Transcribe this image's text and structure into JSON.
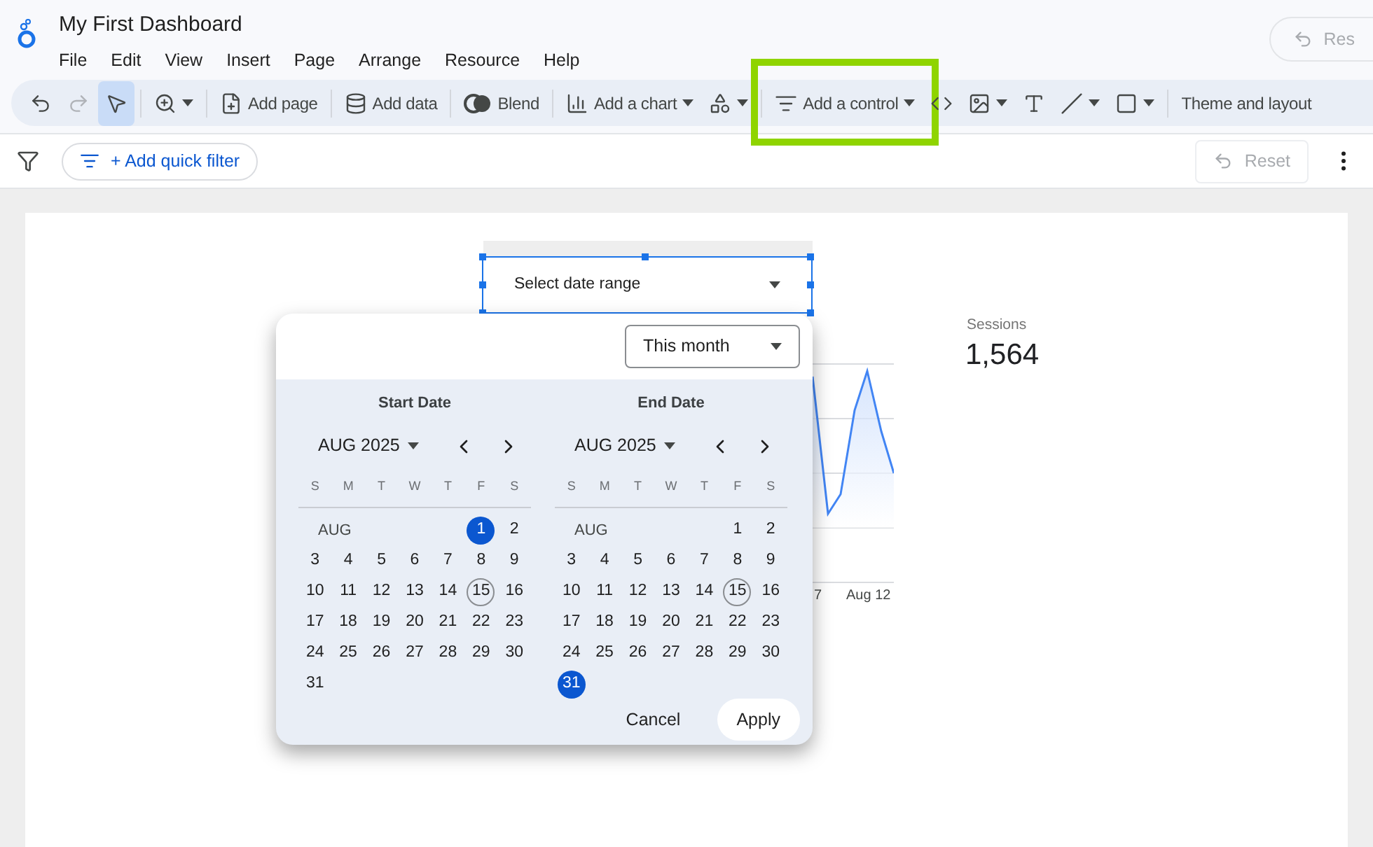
{
  "title": "My First Dashboard",
  "menu": [
    "File",
    "Edit",
    "View",
    "Insert",
    "Page",
    "Arrange",
    "Resource",
    "Help"
  ],
  "header_reset": {
    "label": "Res"
  },
  "toolbar": [
    {
      "kind": "undo",
      "disabled": false
    },
    {
      "kind": "redo",
      "disabled": true
    },
    {
      "kind": "select",
      "selected": true
    },
    {
      "kind": "zoom",
      "caret": true
    },
    {
      "kind": "page",
      "label": "Add page"
    },
    {
      "kind": "data",
      "label": "Add data"
    },
    {
      "kind": "blend",
      "label": "Blend"
    },
    {
      "kind": "chart",
      "label": "Add a chart",
      "caret": true
    },
    {
      "kind": "components",
      "caret": true
    },
    {
      "kind": "control",
      "label": "Add a control",
      "caret": true,
      "highlighted": true
    },
    {
      "kind": "code"
    },
    {
      "kind": "image",
      "caret": true
    },
    {
      "kind": "text"
    },
    {
      "kind": "line",
      "caret": true
    },
    {
      "kind": "shape",
      "caret": true
    },
    {
      "kind": "theme",
      "label": "Theme and layout"
    }
  ],
  "filter_bar": {
    "quick_filter": "+ Add quick filter",
    "reset": {
      "label": "Reset",
      "disabled": true
    }
  },
  "date_control": {
    "label": "Select date range"
  },
  "scorecard": {
    "label": "Sessions",
    "value": "1,564"
  },
  "chart_axis": [
    "7",
    "Aug 12"
  ],
  "date_picker": {
    "preset": "This month",
    "calendars": [
      {
        "title": "Start Date",
        "month": "AUG 2025",
        "weekdays": [
          "S",
          "M",
          "T",
          "W",
          "T",
          "F",
          "S"
        ],
        "month_abbr": "AUG",
        "first_row": [
          {
            "label": "1",
            "selected": true,
            "today": false
          },
          {
            "label": "2",
            "selected": false,
            "today": false
          }
        ],
        "weeks": [
          [
            {
              "label": "3",
              "selected": false,
              "today": false
            },
            {
              "label": "4",
              "selected": false,
              "today": false
            },
            {
              "label": "5",
              "selected": false,
              "today": false
            },
            {
              "label": "6",
              "selected": false,
              "today": false
            },
            {
              "label": "7",
              "selected": false,
              "today": false
            },
            {
              "label": "8",
              "selected": false,
              "today": false
            },
            {
              "label": "9",
              "selected": false,
              "today": false
            }
          ],
          [
            {
              "label": "10",
              "selected": false,
              "today": false
            },
            {
              "label": "11",
              "selected": false,
              "today": false
            },
            {
              "label": "12",
              "selected": false,
              "today": false
            },
            {
              "label": "13",
              "selected": false,
              "today": false
            },
            {
              "label": "14",
              "selected": false,
              "today": false
            },
            {
              "label": "15",
              "selected": false,
              "today": true
            },
            {
              "label": "16",
              "selected": false,
              "today": false
            }
          ],
          [
            {
              "label": "17",
              "selected": false,
              "today": false
            },
            {
              "label": "18",
              "selected": false,
              "today": false
            },
            {
              "label": "19",
              "selected": false,
              "today": false
            },
            {
              "label": "20",
              "selected": false,
              "today": false
            },
            {
              "label": "21",
              "selected": false,
              "today": false
            },
            {
              "label": "22",
              "selected": false,
              "today": false
            },
            {
              "label": "23",
              "selected": false,
              "today": false
            }
          ],
          [
            {
              "label": "24",
              "selected": false,
              "today": false
            },
            {
              "label": "25",
              "selected": false,
              "today": false
            },
            {
              "label": "26",
              "selected": false,
              "today": false
            },
            {
              "label": "27",
              "selected": false,
              "today": false
            },
            {
              "label": "28",
              "selected": false,
              "today": false
            },
            {
              "label": "29",
              "selected": false,
              "today": false
            },
            {
              "label": "30",
              "selected": false,
              "today": false
            }
          ],
          [
            {
              "label": "31",
              "selected": false,
              "today": false
            }
          ]
        ]
      },
      {
        "title": "End Date",
        "month": "AUG 2025",
        "weekdays": [
          "S",
          "M",
          "T",
          "W",
          "T",
          "F",
          "S"
        ],
        "month_abbr": "AUG",
        "first_row": [
          {
            "label": "1",
            "selected": false,
            "today": false
          },
          {
            "label": "2",
            "selected": false,
            "today": false
          }
        ],
        "weeks": [
          [
            {
              "label": "3",
              "selected": false,
              "today": false
            },
            {
              "label": "4",
              "selected": false,
              "today": false
            },
            {
              "label": "5",
              "selected": false,
              "today": false
            },
            {
              "label": "6",
              "selected": false,
              "today": false
            },
            {
              "label": "7",
              "selected": false,
              "today": false
            },
            {
              "label": "8",
              "selected": false,
              "today": false
            },
            {
              "label": "9",
              "selected": false,
              "today": false
            }
          ],
          [
            {
              "label": "10",
              "selected": false,
              "today": false
            },
            {
              "label": "11",
              "selected": false,
              "today": false
            },
            {
              "label": "12",
              "selected": false,
              "today": false
            },
            {
              "label": "13",
              "selected": false,
              "today": false
            },
            {
              "label": "14",
              "selected": false,
              "today": false
            },
            {
              "label": "15",
              "selected": false,
              "today": true
            },
            {
              "label": "16",
              "selected": false,
              "today": false
            }
          ],
          [
            {
              "label": "17",
              "selected": false,
              "today": false
            },
            {
              "label": "18",
              "selected": false,
              "today": false
            },
            {
              "label": "19",
              "selected": false,
              "today": false
            },
            {
              "label": "20",
              "selected": false,
              "today": false
            },
            {
              "label": "21",
              "selected": false,
              "today": false
            },
            {
              "label": "22",
              "selected": false,
              "today": false
            },
            {
              "label": "23",
              "selected": false,
              "today": false
            }
          ],
          [
            {
              "label": "24",
              "selected": false,
              "today": false
            },
            {
              "label": "25",
              "selected": false,
              "today": false
            },
            {
              "label": "26",
              "selected": false,
              "today": false
            },
            {
              "label": "27",
              "selected": false,
              "today": false
            },
            {
              "label": "28",
              "selected": false,
              "today": false
            },
            {
              "label": "29",
              "selected": false,
              "today": false
            },
            {
              "label": "30",
              "selected": false,
              "today": false
            }
          ],
          [
            {
              "label": "31",
              "selected": true,
              "today": false
            }
          ]
        ]
      }
    ],
    "buttons": [
      {
        "kind": "cancel",
        "label": "Cancel"
      },
      {
        "kind": "apply",
        "label": "Apply"
      }
    ]
  }
}
